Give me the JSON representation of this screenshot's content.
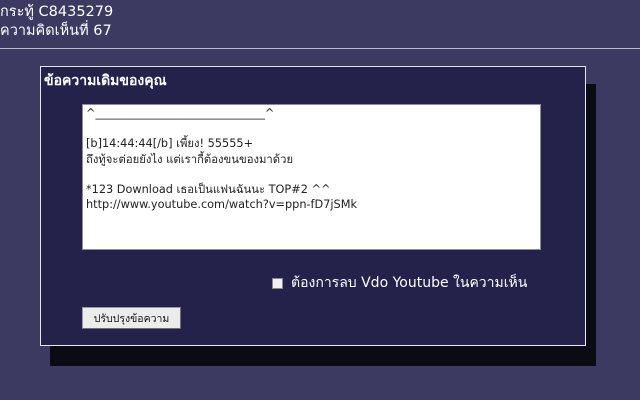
{
  "header": {
    "topic_line": "กระทู้ C8435279",
    "comment_line": "ความคิดเห็นที่ 67"
  },
  "panel": {
    "title": "ข้อความเดิมของคุณ",
    "message_value": "^______________________________^\n\n[b]14:44:44[/b] เพี้ยง! 55555+\nถึงทู้จะต่อยยังไง แต่เรากี้ต้องขนของมาด้วย\n\n*123 Download เธอเป็นแฟนฉันนะ TOP#2 ^^\nhttp://www.youtube.com/watch?v=ppn-fD7jSMk",
    "remove_video_label": "ต้องการลบ Vdo Youtube ในความเห็น",
    "remove_video_checked": false,
    "update_button_label": "ปรับปรุงข้อความ"
  }
}
